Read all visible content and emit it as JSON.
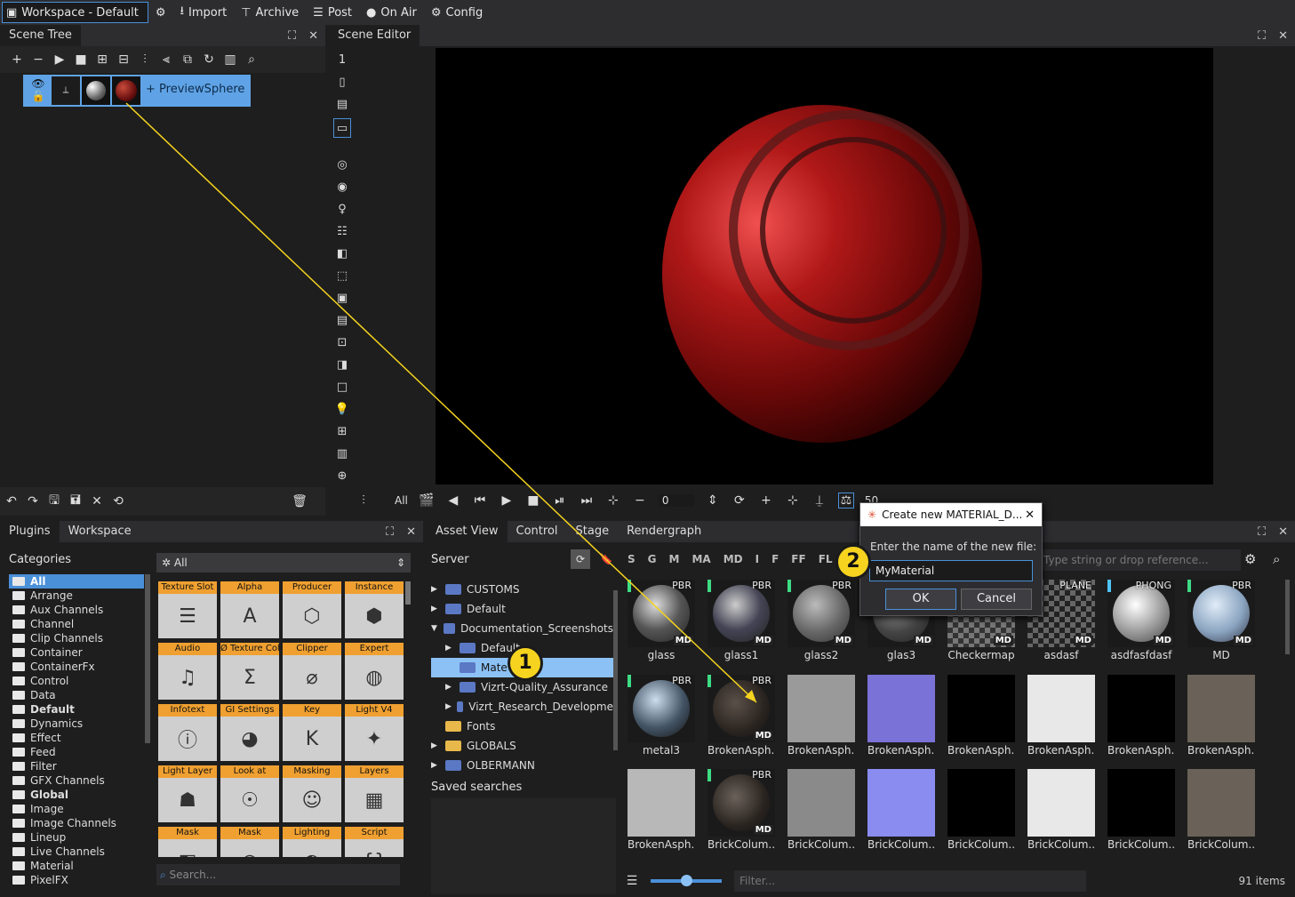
{
  "menubar": {
    "workspace": "Workspace - Default",
    "import": "Import",
    "archive": "Archive",
    "post": "Post",
    "on_air": "On Air",
    "config": "Config"
  },
  "scene_tree": {
    "tab": "Scene Tree",
    "node_label": "PreviewSphere"
  },
  "scene_editor": {
    "tab": "Scene Editor",
    "layer_number": "1",
    "all_label": "All",
    "frame_value": "0",
    "speed_value": "50"
  },
  "plugins_panel": {
    "tabs": [
      "Plugins",
      "Workspace"
    ],
    "categories_label": "Categories",
    "filter_value": "All",
    "categories": [
      {
        "label": "All",
        "bold": true,
        "selected": true
      },
      {
        "label": "Arrange"
      },
      {
        "label": "Aux Channels"
      },
      {
        "label": "Channel"
      },
      {
        "label": "Clip Channels"
      },
      {
        "label": "Container"
      },
      {
        "label": "ContainerFx"
      },
      {
        "label": "Control"
      },
      {
        "label": "Data"
      },
      {
        "label": "Default",
        "bold": true
      },
      {
        "label": "Dynamics"
      },
      {
        "label": "Effect"
      },
      {
        "label": "Feed"
      },
      {
        "label": "Filter"
      },
      {
        "label": "GFX Channels"
      },
      {
        "label": "Global",
        "bold": true
      },
      {
        "label": "Image"
      },
      {
        "label": "Image Channels"
      },
      {
        "label": "Lineup"
      },
      {
        "label": "Live Channels"
      },
      {
        "label": "Material"
      },
      {
        "label": "PixelFX"
      }
    ],
    "plugins": [
      "Texture Slot",
      "Alpha",
      "Producer",
      "Instance",
      "Audio",
      "Ø Texture Color",
      "Clipper",
      "Expert",
      "Infotext",
      "GI Settings",
      "Key",
      "Light V4",
      "Light Layer",
      "Look at",
      "Masking",
      "Layers",
      "Mask",
      "Mask",
      "Lighting",
      "Script"
    ],
    "search_placeholder": "Search..."
  },
  "asset_view": {
    "tabs": [
      "Asset View",
      "Control",
      "Stage",
      "Rendergraph"
    ],
    "server_label": "Server",
    "tree": [
      {
        "label": "CUSTOMS",
        "depth": 0,
        "arrow": "▶"
      },
      {
        "label": "Default",
        "depth": 0,
        "arrow": "▶"
      },
      {
        "label": "Documentation_Screenshots",
        "depth": 0,
        "arrow": "▼"
      },
      {
        "label": "Default",
        "depth": 1,
        "arrow": "▶"
      },
      {
        "label": "Mate",
        "depth": 1,
        "arrow": "",
        "selected": true
      },
      {
        "label": "Vizrt-Quality_Assurance",
        "depth": 1,
        "arrow": "▶"
      },
      {
        "label": "Vizrt_Research_Developme",
        "depth": 1,
        "arrow": "▶"
      },
      {
        "label": "Fonts",
        "depth": 0,
        "arrow": "",
        "yellow": true
      },
      {
        "label": "GLOBALS",
        "depth": 0,
        "arrow": "▶",
        "yellow": true
      },
      {
        "label": "OLBERMANN",
        "depth": 0,
        "arrow": "▶"
      }
    ],
    "saved_searches": "Saved searches",
    "filter_letters": [
      "S",
      "G",
      "M",
      "MA",
      "MD",
      "I",
      "F",
      "FF",
      "FL"
    ],
    "search_placeholder": "Type string or drop reference...",
    "filter_placeholder": "Filter...",
    "item_count": "91 items",
    "assets": [
      {
        "name": "glass",
        "badge": "PBR",
        "md": "MD",
        "mark": "#3ddc84"
      },
      {
        "name": "glass1",
        "badge": "PBR",
        "md": "MD",
        "mark": "#3ddc84"
      },
      {
        "name": "glass2",
        "badge": "PBR",
        "md": "MD",
        "mark": "#3ddc84"
      },
      {
        "name": "glas3",
        "badge": "",
        "md": "MD",
        "mark": ""
      },
      {
        "name": "Checkermap",
        "badge": "",
        "md": "MD",
        "mark": ""
      },
      {
        "name": "asdasf",
        "badge": "PLANE",
        "md": "MD",
        "mark": ""
      },
      {
        "name": "asdfasfdasf",
        "badge": "PHONG",
        "md": "MD",
        "mark": "#4fc3f7"
      },
      {
        "name": "MD",
        "badge": "PBR",
        "md": "MD",
        "mark": "#3ddc84"
      },
      {
        "name": "metal3",
        "badge": "PBR",
        "md": "",
        "mark": "#3ddc84"
      },
      {
        "name": "BrokenAsph...",
        "badge": "PBR",
        "md": "MD",
        "mark": "#3ddc84"
      },
      {
        "name": "BrokenAsph...",
        "badge": "",
        "md": "",
        "mark": ""
      },
      {
        "name": "BrokenAsph...",
        "badge": "",
        "md": "",
        "mark": ""
      },
      {
        "name": "BrokenAsph...",
        "badge": "",
        "md": "",
        "mark": ""
      },
      {
        "name": "BrokenAsph...",
        "badge": "",
        "md": "",
        "mark": ""
      },
      {
        "name": "BrokenAsph...",
        "badge": "",
        "md": "",
        "mark": ""
      },
      {
        "name": "BrokenAsph...",
        "badge": "",
        "md": "",
        "mark": ""
      },
      {
        "name": "BrokenAsph...",
        "badge": "",
        "md": "",
        "mark": ""
      },
      {
        "name": "BrickColum...",
        "badge": "PBR",
        "md": "MD",
        "mark": "#3ddc84"
      },
      {
        "name": "BrickColum...",
        "badge": "",
        "md": "",
        "mark": ""
      },
      {
        "name": "BrickColum...",
        "badge": "",
        "md": "",
        "mark": ""
      },
      {
        "name": "BrickColum...",
        "badge": "",
        "md": "",
        "mark": ""
      },
      {
        "name": "BrickColum...",
        "badge": "",
        "md": "",
        "mark": ""
      },
      {
        "name": "BrickColum...",
        "badge": "",
        "md": "",
        "mark": ""
      },
      {
        "name": "BrickColum...",
        "badge": "",
        "md": "",
        "mark": ""
      }
    ]
  },
  "dialog": {
    "title": "Create new MATERIAL_D...",
    "prompt": "Enter the name of the new file:",
    "value": "MyMaterial",
    "ok": "OK",
    "cancel": "Cancel"
  },
  "callouts": [
    "1",
    "2"
  ],
  "colors": {
    "accent": "#4a90d9",
    "plugin_label": "#f0a030",
    "callout": "#f5d31f",
    "pbr_mark": "#3ddc84",
    "phong_mark": "#4fc3f7"
  }
}
